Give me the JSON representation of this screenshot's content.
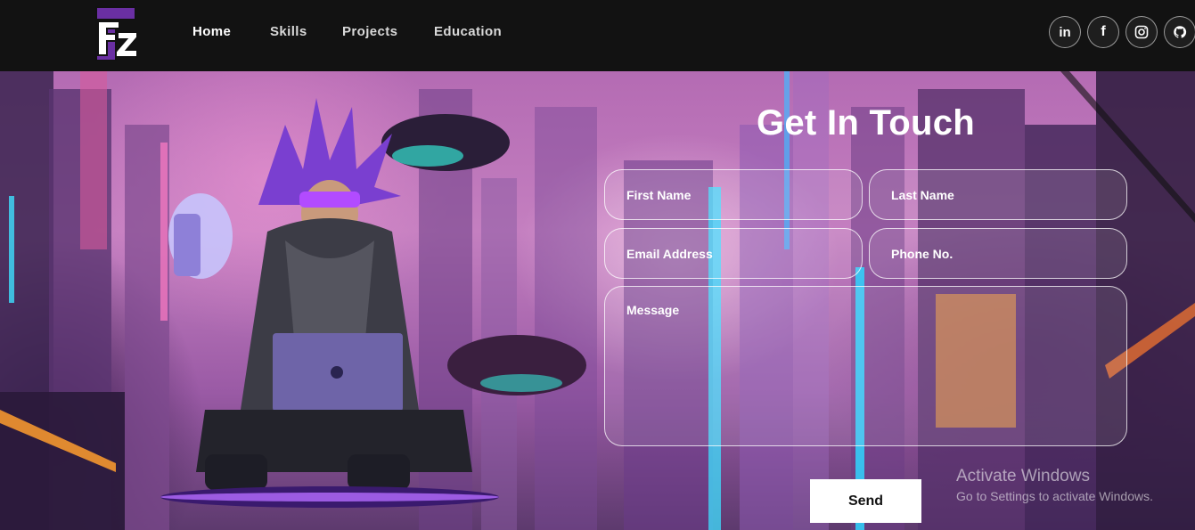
{
  "nav": {
    "logo_text": "FZ",
    "links": [
      {
        "label": "Home",
        "active": true
      },
      {
        "label": "Skills",
        "active": false
      },
      {
        "label": "Projects",
        "active": false
      },
      {
        "label": "Education",
        "active": false
      }
    ],
    "social": [
      {
        "icon": "linkedin-icon",
        "glyph": "in"
      },
      {
        "icon": "facebook-icon",
        "glyph": "f"
      },
      {
        "icon": "instagram-icon"
      },
      {
        "icon": "github-icon"
      }
    ]
  },
  "contact": {
    "title": "Get In Touch",
    "first_name": {
      "value": "",
      "placeholder": "First Name"
    },
    "last_name": {
      "value": "",
      "placeholder": "Last Name"
    },
    "email": {
      "value": "",
      "placeholder": "Email Address"
    },
    "phone": {
      "value": "",
      "placeholder": "Phone No."
    },
    "message": {
      "value": "",
      "placeholder": "Message"
    },
    "send_label": "Send"
  },
  "watermark": {
    "title": "Activate Windows",
    "subtitle": "Go to Settings to activate Windows."
  },
  "colors": {
    "navbar_bg": "#121212",
    "text": "#ffffff",
    "accent": "#7b2fbf"
  }
}
